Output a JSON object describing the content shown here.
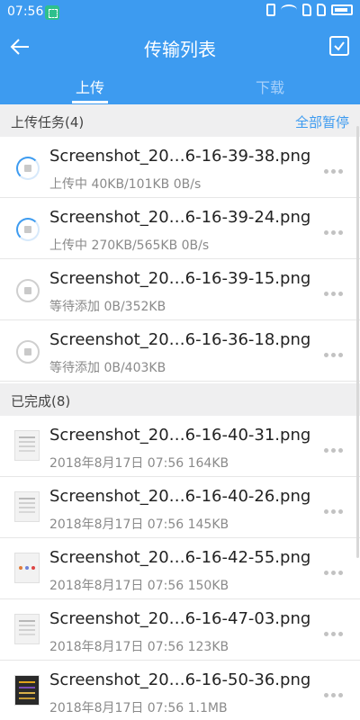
{
  "status_bar": {
    "time": "07:56"
  },
  "header": {
    "title": "传输列表"
  },
  "tabs": [
    {
      "label": "上传",
      "active": true
    },
    {
      "label": "下载",
      "active": false
    }
  ],
  "uploading_section": {
    "title": "上传任务(4)",
    "action": "全部暂停",
    "items": [
      {
        "name": "Screenshot_20…6-16-39-38.png",
        "meta": "上传中 40KB/101KB 0B/s",
        "state": "uploading"
      },
      {
        "name": "Screenshot_20…6-16-39-24.png",
        "meta": "上传中 270KB/565KB 0B/s",
        "state": "uploading"
      },
      {
        "name": "Screenshot_20…6-16-39-15.png",
        "meta": "等待添加 0B/352KB",
        "state": "waiting"
      },
      {
        "name": "Screenshot_20…6-16-36-18.png",
        "meta": "等待添加 0B/403KB",
        "state": "waiting"
      }
    ]
  },
  "completed_section": {
    "title": "已完成(8)",
    "items": [
      {
        "name": "Screenshot_20…6-16-40-31.png",
        "meta": "2018年8月17日 07:56 164KB"
      },
      {
        "name": "Screenshot_20…6-16-40-26.png",
        "meta": "2018年8月17日 07:56 145KB"
      },
      {
        "name": "Screenshot_20…6-16-42-55.png",
        "meta": "2018年8月17日 07:56 150KB"
      },
      {
        "name": "Screenshot_20…6-16-47-03.png",
        "meta": "2018年8月17日 07:56 123KB"
      },
      {
        "name": "Screenshot_20…6-16-50-36.png",
        "meta": "2018年8月17日 07:56 1.1MB"
      }
    ]
  },
  "colors": {
    "accent": "#3d9bf0",
    "section_bg": "#efeff0"
  }
}
